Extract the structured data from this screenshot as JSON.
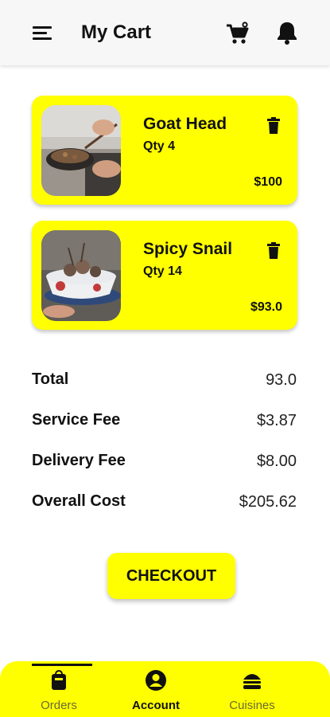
{
  "header": {
    "title": "My Cart",
    "menu_icon": "hamburger-menu-icon",
    "cart_icon": "shopping-cart-icon",
    "notification_icon": "bell-icon"
  },
  "cart": {
    "items": [
      {
        "name": "Goat Head",
        "qty": "Qty 4",
        "price": "$100",
        "image": "goat-head-cooking-photo"
      },
      {
        "name": "Spicy Snail",
        "qty": "Qty 14",
        "price": "$93.0",
        "image": "spicy-snail-bowl-photo"
      }
    ]
  },
  "summary": {
    "total_label": "Total",
    "total_value": "93.0",
    "service_fee_label": "Service Fee",
    "service_fee_value": "$3.87",
    "delivery_fee_label": "Delivery Fee",
    "delivery_fee_value": "$8.00",
    "overall_label": "Overall Cost",
    "overall_value": "$205.62"
  },
  "checkout_label": "CHECKOUT",
  "bottom_nav": {
    "items": [
      {
        "label": "Orders",
        "icon": "shopping-bag-icon",
        "active": false
      },
      {
        "label": "Account",
        "icon": "account-circle-icon",
        "active": true
      },
      {
        "label": "Cuisines",
        "icon": "burger-icon",
        "active": false
      }
    ]
  },
  "colors": {
    "accent": "#ffff00",
    "text": "#111111",
    "appbar": "#f7f7f7",
    "inactive_nav": "#6a6a35"
  }
}
